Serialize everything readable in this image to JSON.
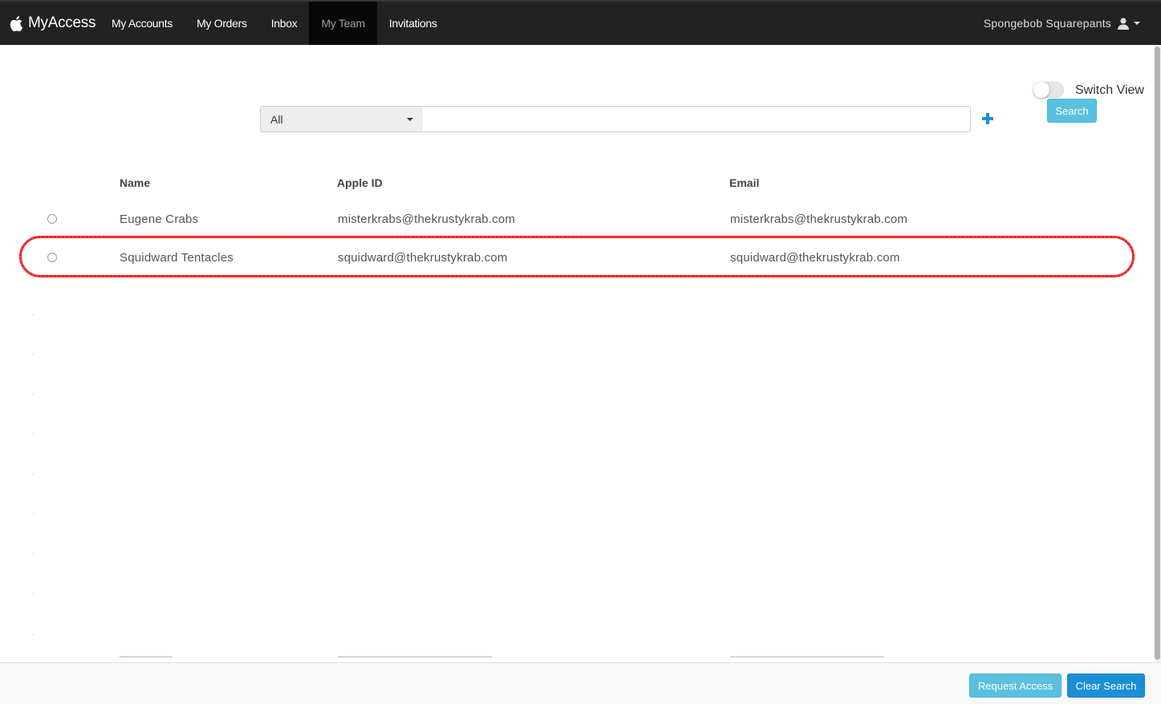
{
  "navbar": {
    "brand": "MyAccess",
    "items": [
      {
        "label": "My Accounts",
        "active": false
      },
      {
        "label": "My Orders",
        "active": false
      },
      {
        "label": "Inbox",
        "active": false
      },
      {
        "label": "My Team",
        "active": true
      },
      {
        "label": "Invitations",
        "active": false
      }
    ],
    "user_name": "Spongebob Squarepants"
  },
  "controls": {
    "switch_view_label": "Switch View",
    "switch_view_on": false,
    "search_button": "Search",
    "filter_selected": "All",
    "search_value": "",
    "search_placeholder": ""
  },
  "table": {
    "columns": [
      "Name",
      "Apple ID",
      "Email"
    ],
    "rows": [
      {
        "name": "Eugene Crabs",
        "apple_id": "misterkrabs@thekrustykrab.com",
        "email": "misterkrabs@thekrustykrab.com",
        "selected": false
      },
      {
        "name": "Squidward Tentacles",
        "apple_id": "squidward@thekrustykrab.com",
        "email": "squidward@thekrustykrab.com",
        "selected": false,
        "highlighted": true
      }
    ]
  },
  "footer": {
    "request_access": "Request Access",
    "clear_search": "Clear Search"
  },
  "colors": {
    "navbar_bg": "#222222",
    "accent_light": "#5bc0de",
    "accent_primary": "#1a8fd6",
    "highlight": "#ef1b1b"
  }
}
